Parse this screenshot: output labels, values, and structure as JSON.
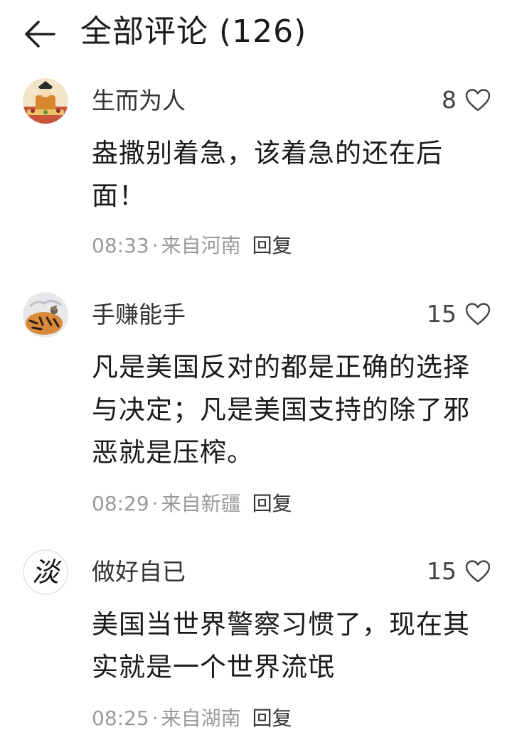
{
  "header": {
    "back_icon": "arrow-left-icon",
    "title": "全部评论 (126)"
  },
  "comments": [
    {
      "avatar_icon": "avatar-figure-icon",
      "username": "生而为人",
      "likes": "8",
      "text": "盎撒别着急，该着急的还在后面！",
      "time": "08:33",
      "separator": "·",
      "location": "来自河南",
      "reply_label": "回复"
    },
    {
      "avatar_icon": "avatar-tiger-icon",
      "username": "手赚能手",
      "likes": "15",
      "text": "凡是美国反对的都是正确的选择与决定；凡是美国支持的除了邪恶就是压榨。",
      "time": "08:29",
      "separator": "·",
      "location": "来自新疆",
      "reply_label": "回复"
    },
    {
      "avatar_icon": "avatar-calligraphy-icon",
      "avatar_char": "淡",
      "username": "做好自已",
      "likes": "15",
      "text": "美国当世界警察习惯了，现在其实就是一个世界流氓",
      "time": "08:25",
      "separator": "·",
      "location": "来自湖南",
      "reply_label": "回复"
    }
  ],
  "colors": {
    "text_primary": "#1a1a1a",
    "text_meta": "#9a9a9a",
    "background": "#ffffff"
  }
}
